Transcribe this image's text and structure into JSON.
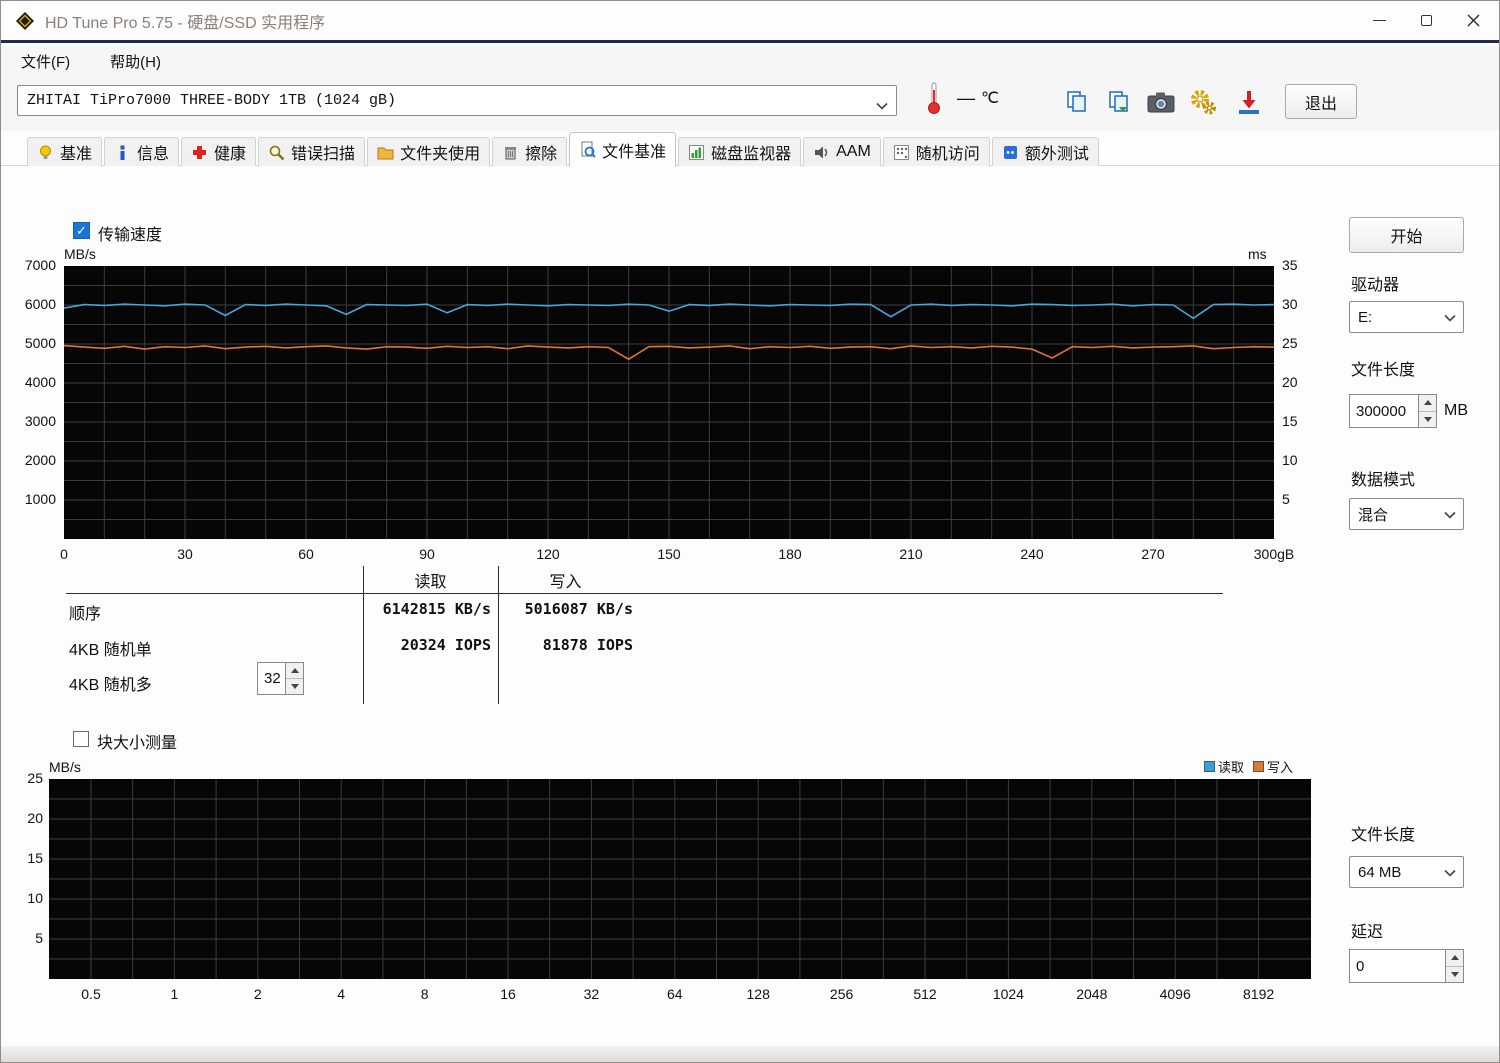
{
  "window": {
    "title": "HD Tune Pro 5.75 - 硬盘/SSD 实用程序"
  },
  "menu": {
    "items": [
      {
        "label": "文件(F)"
      },
      {
        "label": "帮助(H)"
      }
    ]
  },
  "toolbar": {
    "drive_combo": "ZHITAI TiPro7000 THREE-BODY 1TB (1024 gB)",
    "temperature": {
      "value": "—",
      "unit": "℃"
    },
    "exit_label": "退出"
  },
  "tabs": [
    {
      "label": "基准",
      "icon": "bulb",
      "active": false
    },
    {
      "label": "信息",
      "icon": "info",
      "active": false
    },
    {
      "label": "健康",
      "icon": "health",
      "active": false
    },
    {
      "label": "错误扫描",
      "icon": "scan",
      "active": false
    },
    {
      "label": "文件夹使用",
      "icon": "folder",
      "active": false
    },
    {
      "label": "擦除",
      "icon": "erase",
      "active": false
    },
    {
      "label": "文件基准",
      "icon": "filebench",
      "active": true
    },
    {
      "label": "磁盘监视器",
      "icon": "monitor",
      "active": false
    },
    {
      "label": "AAM",
      "icon": "aam",
      "active": false
    },
    {
      "label": "随机访问",
      "icon": "random",
      "active": false
    },
    {
      "label": "额外测试",
      "icon": "extra",
      "active": false
    }
  ],
  "benchmark": {
    "transfer_speed_label": "传输速度",
    "transfer_speed_checked": true,
    "start_button": "开始",
    "drive_label": "驱动器",
    "drive_value": "E:",
    "file_length_label": "文件长度",
    "file_length_value": "300000",
    "file_length_unit": "MB",
    "data_mode_label": "数据模式",
    "data_mode_value": "混合",
    "results": {
      "col_read": "读取",
      "col_write": "写入",
      "rows": [
        {
          "label": "顺序",
          "read": "6142815 KB/s",
          "write": "5016087 KB/s"
        },
        {
          "label": "4KB 随机单",
          "read": "20324 IOPS",
          "write": "81878 IOPS"
        },
        {
          "label": "4KB 随机多",
          "read": "",
          "write": ""
        }
      ],
      "queue_depth": "32"
    }
  },
  "block_section": {
    "checkbox_label": "块大小测量",
    "checked": false,
    "legend": [
      {
        "label": "读取",
        "color": "#2ea3dc"
      },
      {
        "label": "写入",
        "color": "#e2762c"
      }
    ],
    "file_length_label": "文件长度",
    "file_length_value": "64 MB",
    "latency_label": "延迟",
    "latency_value": "0"
  },
  "chart_data": [
    {
      "type": "line",
      "title": "传输速度",
      "xlim": [
        0,
        300
      ],
      "x_ticks": [
        0,
        30,
        60,
        90,
        120,
        150,
        180,
        210,
        240,
        270,
        300
      ],
      "x_tick_labels": [
        "0",
        "30",
        "60",
        "90",
        "120",
        "150",
        "180",
        "210",
        "240",
        "270",
        "300gB"
      ],
      "x_grid_step": 10,
      "left_axis": {
        "label": "MB/s",
        "min": 0,
        "max": 7000,
        "tick_step": 1000,
        "grid_step": 500
      },
      "right_axis": {
        "label": "ms",
        "min": 0,
        "max": 35,
        "tick_step": 5
      },
      "grid": true,
      "legend_position": "none",
      "series": [
        {
          "name": "读取",
          "color": "#44a7dd",
          "x_step": 5,
          "values": [
            5920,
            6010,
            5990,
            6020,
            6000,
            5980,
            6020,
            6000,
            5730,
            6010,
            5990,
            6020,
            6000,
            5980,
            5760,
            6010,
            6000,
            5990,
            6020,
            5800,
            6010,
            5990,
            6020,
            6000,
            5980,
            6010,
            6000,
            5990,
            6020,
            6000,
            5840,
            6010,
            5990,
            6020,
            6000,
            5980,
            6010,
            6000,
            5990,
            6020,
            6010,
            5700,
            6000,
            6020,
            5990,
            6010,
            6000,
            5980,
            6020,
            6010,
            5990,
            6000,
            6020,
            5980,
            6010,
            6000,
            5660,
            6010,
            6020,
            6000,
            6010
          ]
        },
        {
          "name": "写入",
          "color": "#e2762c",
          "x_step": 5,
          "values": [
            4960,
            4920,
            4890,
            4940,
            4870,
            4930,
            4910,
            4950,
            4880,
            4920,
            4940,
            4900,
            4930,
            4950,
            4900,
            4870,
            4930,
            4920,
            4890,
            4940,
            4910,
            4930,
            4880,
            4950,
            4920,
            4900,
            4930,
            4910,
            4610,
            4930,
            4940,
            4900,
            4920,
            4950,
            4880,
            4930,
            4910,
            4940,
            4890,
            4920,
            4930,
            4880,
            4950,
            4910,
            4930,
            4900,
            4940,
            4920,
            4870,
            4640,
            4930,
            4910,
            4940,
            4900,
            4920,
            4930,
            4950,
            4880,
            4910,
            4930,
            4920
          ]
        }
      ]
    },
    {
      "type": "line",
      "title": "块大小测量",
      "x_tick_labels": [
        "0.5",
        "1",
        "2",
        "4",
        "8",
        "16",
        "32",
        "64",
        "128",
        "256",
        "512",
        "1024",
        "2048",
        "4096",
        "8192"
      ],
      "left_axis": {
        "label": "MB/s",
        "min": 0,
        "max": 25,
        "tick_step": 5,
        "grid_step": 2.5
      },
      "grid": true,
      "legend_position": "top-right",
      "series": []
    }
  ]
}
